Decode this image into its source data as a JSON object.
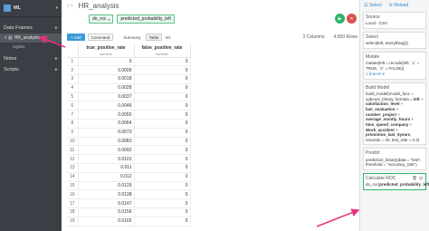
{
  "sidebar": {
    "app_title": "ML",
    "sections": {
      "data_frames": "Data Frames",
      "notes": "Notes",
      "scripts": "Scripts"
    },
    "active_item": "HR_analysis",
    "sub_item": "logistic",
    "tag": "▾ ▦"
  },
  "main": {
    "project_title": "HR_analysis",
    "tokens": {
      "function": "do_roc",
      "column": "predicted_probability_left"
    },
    "toolbar": {
      "add": "+ Add",
      "command": "Command",
      "summary": "Summary",
      "table": "Table",
      "viz": "Viz",
      "columns": "2 Columns",
      "rows": "4,500 Rows"
    },
    "grid": {
      "columns": [
        {
          "name": "true_positive_rate",
          "type": "numeric"
        },
        {
          "name": "false_positive_rate",
          "type": "numeric"
        }
      ],
      "rows": [
        [
          "1",
          "0",
          "0"
        ],
        [
          "2",
          "0.0009",
          "0"
        ],
        [
          "3",
          "0.0018",
          "0"
        ],
        [
          "4",
          "0.0028",
          "0"
        ],
        [
          "5",
          "0.0037",
          "0"
        ],
        [
          "6",
          "0.0046",
          "0"
        ],
        [
          "7",
          "0.0055",
          "0"
        ],
        [
          "8",
          "0.0064",
          "0"
        ],
        [
          "9",
          "0.0073",
          "0"
        ],
        [
          "10",
          "0.0083",
          "0"
        ],
        [
          "11",
          "0.0092",
          "0"
        ],
        [
          "12",
          "0.0101",
          "0"
        ],
        [
          "13",
          "0.011",
          "0"
        ],
        [
          "14",
          "0.012",
          "0"
        ],
        [
          "15",
          "0.0129",
          "0"
        ],
        [
          "16",
          "0.0138",
          "0"
        ],
        [
          "17",
          "0.0147",
          "0"
        ],
        [
          "18",
          "0.0156",
          "0"
        ],
        [
          "19",
          "0.0165",
          "0"
        ]
      ]
    }
  },
  "right_panel": {
    "select": "Select",
    "reload": "Reload",
    "steps": [
      {
        "title": "Source",
        "body": "Local - CSV"
      },
      {
        "title": "Select",
        "body": "select(left, everything())"
      },
      {
        "title": "Mutate",
        "body": "mutate(left = recode(left, `1` = TRUE, `0` = FALSE))",
        "branch": "1 branch ▾"
      },
      {
        "title": "Build Model",
        "body_parts": [
          "build_model(model_func = xgboost_binary, formula = ",
          "left",
          " ~ ",
          "satisfaction_level",
          " + ",
          "last_evaluation",
          " + ",
          "number_project",
          " + ",
          "average_montly_hours",
          " + ",
          "time_spend_company",
          " + ",
          "Work_accident",
          " + ",
          "promotion_last_5years",
          ", nrounds = 20, test_rate = 0.3)"
        ]
      },
      {
        "title": "Predict",
        "body": "prediction_binary(data = \"test\", threshold = \"accuracy_rate\")"
      },
      {
        "title": "Calculate ROC",
        "body_parts": [
          "do_roc(",
          "predicted_probability_left",
          ")"
        ]
      }
    ]
  },
  "colors": {
    "sidebar_bg": "#3b3f45",
    "accent_green": "#2fb56a",
    "accent_red": "#d9534f",
    "link_blue": "#2d8bd2",
    "callout_pink": "#e8307a"
  }
}
